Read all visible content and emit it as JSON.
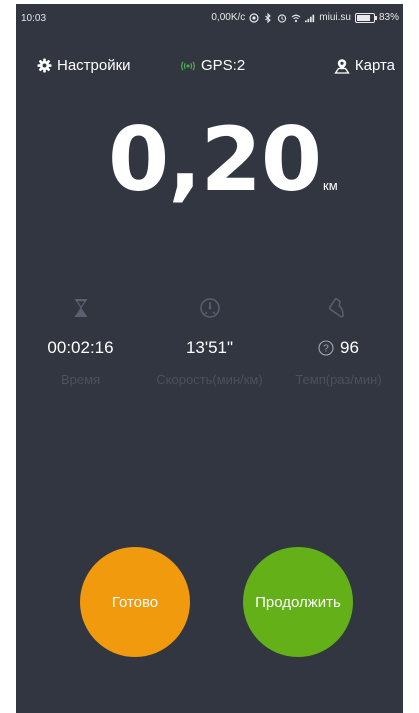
{
  "status_bar": {
    "time": "10:03",
    "speed": "0,00K/c",
    "operator": "miui.su",
    "battery": "83%",
    "battery_level": 0.83
  },
  "header": {
    "settings_label": "Настройки",
    "gps_label": "GPS:2",
    "map_label": "Карта"
  },
  "distance": {
    "value": "0,20",
    "unit": "км"
  },
  "stats": [
    {
      "icon": "hourglass-icon",
      "value": "00:02:16",
      "label": "Время"
    },
    {
      "icon": "speedometer-icon",
      "value": "13'51\"",
      "label": "Скорость(мин/км)"
    },
    {
      "icon": "shoe-icon",
      "value": "96",
      "label": "Темп(раз/мин)"
    }
  ],
  "buttons": {
    "done_label": "Готово",
    "continue_label": "Продолжить"
  },
  "colors": {
    "background": "#323640",
    "done_button": "#f19a0e",
    "continue_button": "#63b019",
    "gps_signal": "#4caf50",
    "muted_label": "#4b505b"
  }
}
